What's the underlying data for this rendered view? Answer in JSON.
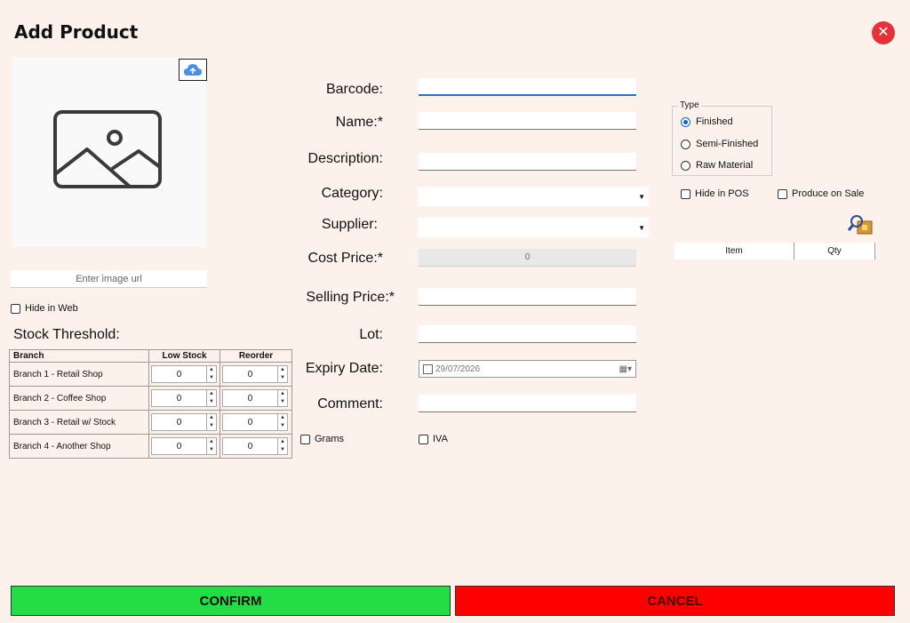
{
  "window": {
    "title": "Add Product",
    "close_icon": "close-icon"
  },
  "image": {
    "placeholder_icon": "image-icon",
    "upload_icon": "cloud-upload-icon",
    "url_placeholder": "Enter image url"
  },
  "hide_in_web": "Hide in Web",
  "stock": {
    "title": "Stock Threshold:",
    "columns": [
      "Branch",
      "Low Stock",
      "Reorder"
    ],
    "rows": [
      {
        "branch": "Branch 1 - Retail Shop",
        "low": "0",
        "reorder": "0"
      },
      {
        "branch": "Branch 2 - Coffee Shop",
        "low": "0",
        "reorder": "0"
      },
      {
        "branch": "Branch 3 - Retail w/ Stock",
        "low": "0",
        "reorder": "0"
      },
      {
        "branch": "Branch 4 - Another Shop",
        "low": "0",
        "reorder": "0"
      }
    ]
  },
  "form": {
    "barcode": "Barcode:",
    "name": "Name:*",
    "description": "Description:",
    "category": "Category:",
    "supplier": "Supplier:",
    "cost_price": "Cost Price:*",
    "cost_value": "0",
    "selling_price": "Selling Price:*",
    "lot": "Lot:",
    "expiry_date": "Expiry Date:",
    "expiry_value": "29/07/2026",
    "comment": "Comment:",
    "grams": "Grams",
    "iva": "IVA"
  },
  "type": {
    "legend": "Type",
    "options": [
      "Finished",
      "Semi-Finished",
      "Raw Material"
    ],
    "selected": "Finished"
  },
  "hide_in_pos": "Hide in POS",
  "produce_on_sale": "Produce on Sale",
  "parts": {
    "search_icon": "search-package-icon",
    "columns": [
      "Item",
      "Qty"
    ]
  },
  "buttons": {
    "confirm": "CONFIRM",
    "cancel": "CANCEL"
  },
  "colors": {
    "background": "#fdf1ec",
    "confirm": "#22dd44",
    "cancel": "#ff0000",
    "close": "#e5323a",
    "accent": "#1565c0"
  }
}
